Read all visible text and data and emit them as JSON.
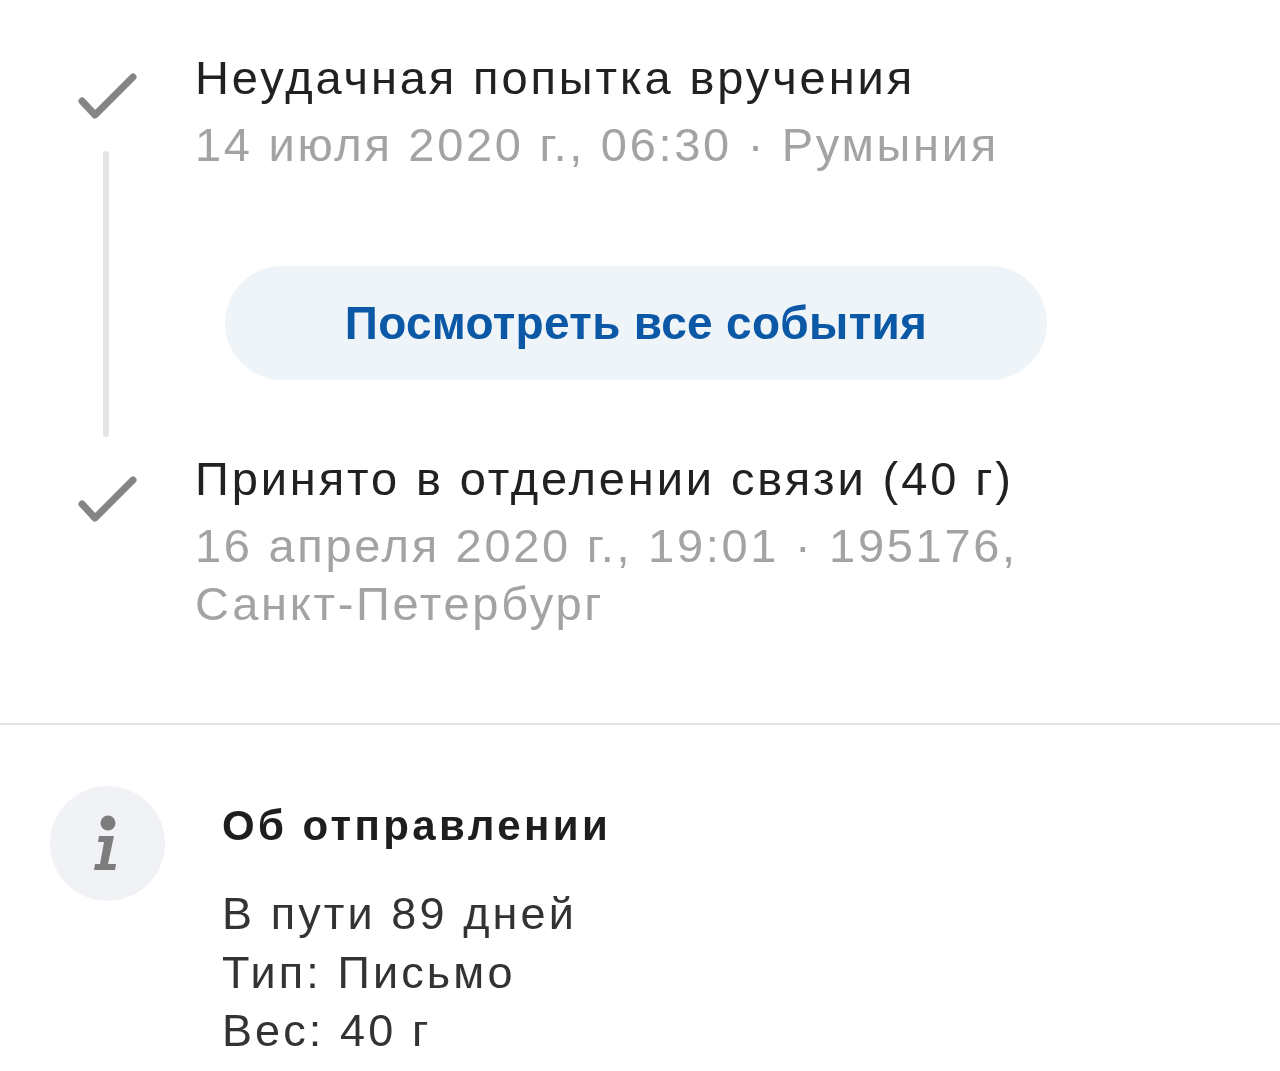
{
  "timeline": [
    {
      "kind": "event",
      "title": "Неудачная попытка вручения",
      "details": "14 июля 2020 г., 06:30 · Румыния"
    },
    {
      "kind": "more_button",
      "label": "Посмотреть все события"
    },
    {
      "kind": "event",
      "title": "Принято в отделении связи (40 г)",
      "details": "16 апреля 2020 г., 19:01 · 195176, Санкт-Петербург"
    }
  ],
  "shipment_info": {
    "title": "Об отправлении",
    "lines": [
      "В пути 89 дней",
      "Тип: Письмо",
      "Вес: 40 г"
    ]
  }
}
